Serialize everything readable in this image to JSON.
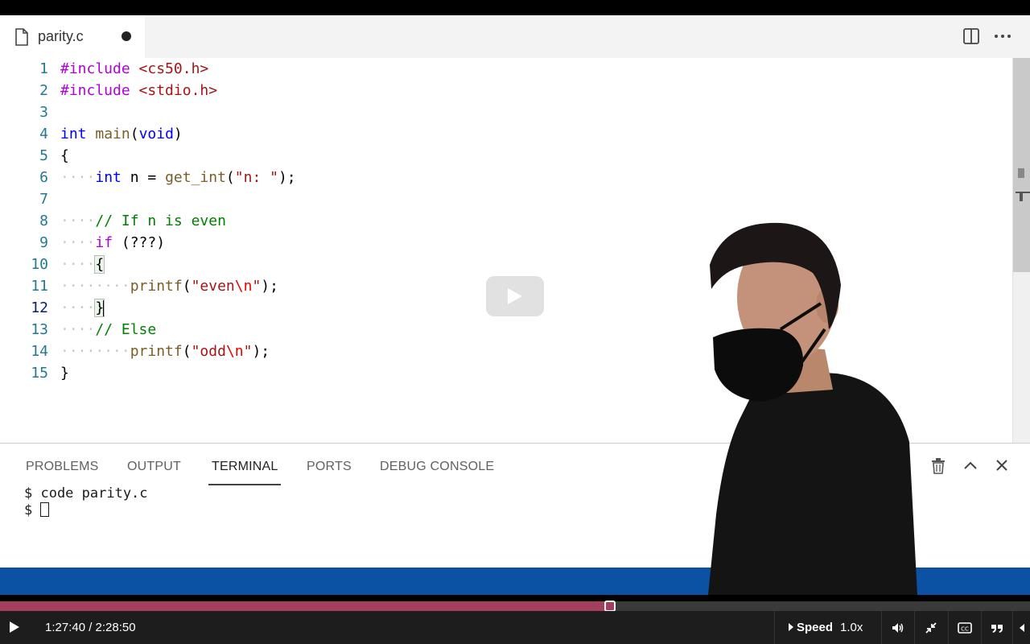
{
  "tab": {
    "filename": "parity.c",
    "dirty": true
  },
  "editor": {
    "lines": [
      {
        "n": "1"
      },
      {
        "n": "2"
      },
      {
        "n": "3"
      },
      {
        "n": "4"
      },
      {
        "n": "5"
      },
      {
        "n": "6"
      },
      {
        "n": "7"
      },
      {
        "n": "8"
      },
      {
        "n": "9"
      },
      {
        "n": "10"
      },
      {
        "n": "11"
      },
      {
        "n": "12"
      },
      {
        "n": "13"
      },
      {
        "n": "14"
      },
      {
        "n": "15"
      }
    ],
    "tokens": {
      "l1_pre": "#include",
      "l1_inc": "<cs50.h>",
      "l2_pre": "#include",
      "l2_inc": "<stdio.h>",
      "l4_type": "int",
      "l4_fn": "main",
      "l4_paren_open": "(",
      "l4_void": "void",
      "l4_paren_close": ")",
      "l5_brace": "{",
      "l6_type": "int",
      "l6_rest1": " n = ",
      "l6_fn": "get_int",
      "l6_p": "(",
      "l6_str": "\"n: \"",
      "l6_end": ");",
      "l8_cmt": "// If n is even",
      "l9_kw": "if",
      "l9_rest": " (???)",
      "l10_brace": "{",
      "l11_fn": "printf",
      "l11_p": "(",
      "l11_str1": "\"even",
      "l11_esc": "\\n",
      "l11_str2": "\"",
      "l11_end": ");",
      "l12_brace": "}",
      "l13_cmt": "// Else",
      "l14_fn": "printf",
      "l14_p": "(",
      "l14_str1": "\"odd",
      "l14_esc": "\\n",
      "l14_str2": "\"",
      "l14_end": ");",
      "l15_brace": "}"
    },
    "active_line": "12"
  },
  "panel": {
    "tabs": [
      "PROBLEMS",
      "OUTPUT",
      "TERMINAL",
      "PORTS",
      "DEBUG CONSOLE"
    ],
    "active_tab": "TERMINAL",
    "terminal_line1": "$ code parity.c",
    "terminal_line2": "$ "
  },
  "video": {
    "time": "1:27:40 / 2:28:50",
    "progress": 0.592,
    "speed_label": "Speed",
    "speed_value": "1.0x"
  },
  "colors": {
    "statusbar": "#0b52a5",
    "progress": "#a33f5d"
  },
  "icons": [
    "file-icon",
    "split-editor-icon",
    "more-icon",
    "trash-icon",
    "chevron-up-icon",
    "close-icon",
    "play-icon",
    "volume-icon",
    "exit-fullscreen-icon",
    "captions-icon",
    "transcript-icon"
  ]
}
